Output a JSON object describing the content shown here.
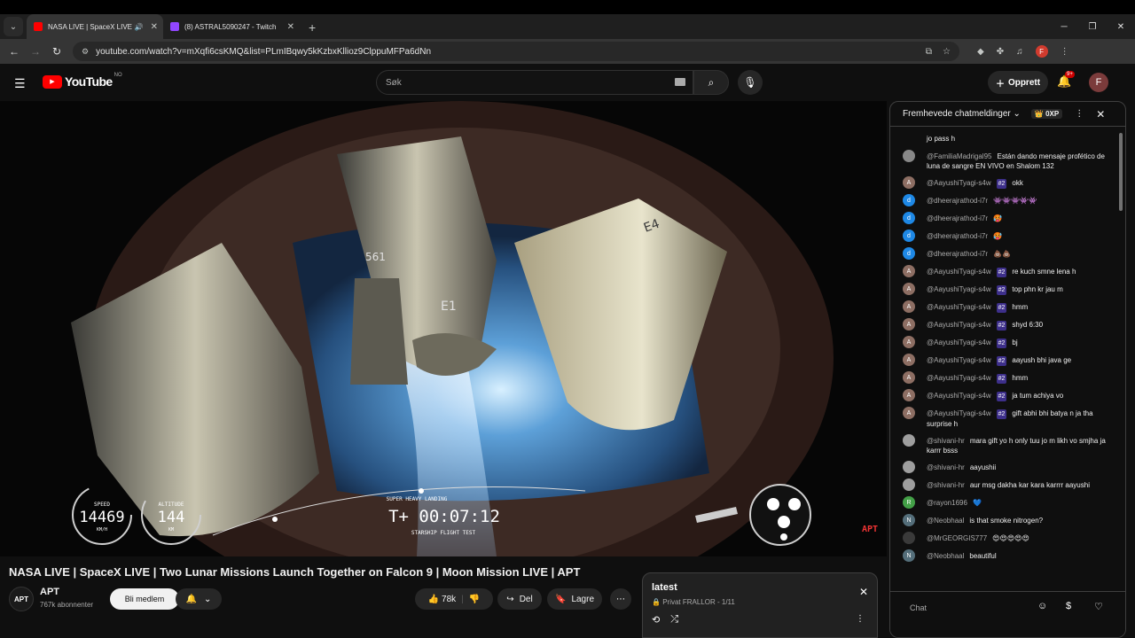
{
  "browser": {
    "tabs": [
      {
        "title": "NASA LIVE | SpaceX LIVE | T",
        "active": true
      },
      {
        "title": "(8) ASTRAL5090247 - Twitch",
        "active": false
      }
    ],
    "url": "youtube.com/watch?v=mXqfi6csKMQ&list=PLmIBqwy5kKzbxKllioz9ClppuMFPa6dNn",
    "profile_initial": "F"
  },
  "youtube": {
    "logo": "YouTube",
    "region": "NO",
    "search_placeholder": "Søk",
    "create_label": "Opprett",
    "notif_badge": "9+",
    "avatar_initial": "F"
  },
  "video": {
    "title": "NASA LIVE | SpaceX LIVE | Two Lunar Missions Launch Together on Falcon 9 | Moon Mission LIVE | APT",
    "hud": {
      "speed_label": "SPEED",
      "speed_value": "14469",
      "speed_unit": "KM/H",
      "altitude_label": "ALTITUDE",
      "altitude_value": "144",
      "altitude_unit": "KM",
      "event": "SUPER HEAVY LANDING",
      "timer": "T+ 00:07:12",
      "mission": "STARSHIP FLIGHT TEST",
      "engines": [
        "561",
        "E1",
        "E4"
      ],
      "watermark": "APT"
    }
  },
  "channel": {
    "logo_text": "APT",
    "name": "APT",
    "subs": "767k abonnenter",
    "member_btn": "Bli medlem"
  },
  "actions": {
    "likes": "78k",
    "share": "Del",
    "save": "Lagre"
  },
  "playlist": {
    "title": "latest",
    "subtitle": "Privat FRALLOR - 1/11"
  },
  "chat": {
    "header": "Fremhevede chatmeldinger",
    "xp": "0XP",
    "input_placeholder": "Chat",
    "messages": [
      {
        "author": "",
        "badge": "",
        "text": "jo pass h",
        "avatar": "",
        "color": "#777777"
      },
      {
        "author": "@FamiliaMadrigal95",
        "badge": "",
        "text": "Están dando mensaje profético de luna de sangre EN VIVO en Shalom 132",
        "avatar": "",
        "color": "#888888"
      },
      {
        "author": "@AayushiTyagi-s4w",
        "badge": "#2",
        "text": "okk",
        "avatar": "A",
        "color": "#8d6e63"
      },
      {
        "author": "@dheerajrathod-i7r",
        "badge": "",
        "text": "👾👾👾👾👾",
        "avatar": "d",
        "color": "#1e88e5"
      },
      {
        "author": "@dheerajrathod-i7r",
        "badge": "",
        "text": "🥵",
        "avatar": "d",
        "color": "#1e88e5"
      },
      {
        "author": "@dheerajrathod-i7r",
        "badge": "",
        "text": "🥵",
        "avatar": "d",
        "color": "#1e88e5"
      },
      {
        "author": "@dheerajrathod-i7r",
        "badge": "",
        "text": "💩💩",
        "avatar": "d",
        "color": "#1e88e5"
      },
      {
        "author": "@AayushiTyagi-s4w",
        "badge": "#2",
        "text": "re kuch smne lena h",
        "avatar": "A",
        "color": "#8d6e63"
      },
      {
        "author": "@AayushiTyagi-s4w",
        "badge": "#2",
        "text": "top phn kr jau m",
        "avatar": "A",
        "color": "#8d6e63"
      },
      {
        "author": "@AayushiTyagi-s4w",
        "badge": "#2",
        "text": "hmm",
        "avatar": "A",
        "color": "#8d6e63"
      },
      {
        "author": "@AayushiTyagi-s4w",
        "badge": "#2",
        "text": "shyd 6:30",
        "avatar": "A",
        "color": "#8d6e63"
      },
      {
        "author": "@AayushiTyagi-s4w",
        "badge": "#2",
        "text": "bj",
        "avatar": "A",
        "color": "#8d6e63"
      },
      {
        "author": "@AayushiTyagi-s4w",
        "badge": "#2",
        "text": "aayush bhi java ge",
        "avatar": "A",
        "color": "#8d6e63"
      },
      {
        "author": "@AayushiTyagi-s4w",
        "badge": "#2",
        "text": "hmm",
        "avatar": "A",
        "color": "#8d6e63"
      },
      {
        "author": "@AayushiTyagi-s4w",
        "badge": "#2",
        "text": "ja tum achiya vo",
        "avatar": "A",
        "color": "#8d6e63"
      },
      {
        "author": "@AayushiTyagi-s4w",
        "badge": "#2",
        "text": "gift abhi bhi batya n ja tha surprise h",
        "avatar": "A",
        "color": "#8d6e63"
      },
      {
        "author": "@shivani-hr",
        "badge": "",
        "text": "mara gift yo h only tuu jo m likh vo smjha ja karrr bsss",
        "avatar": "",
        "color": "#9e9e9e"
      },
      {
        "author": "@shivani-hr",
        "badge": "",
        "text": "aayushii",
        "avatar": "",
        "color": "#9e9e9e"
      },
      {
        "author": "@shivani-hr",
        "badge": "",
        "text": "aur msg dakha kar kara karrrr aayushi",
        "avatar": "",
        "color": "#9e9e9e"
      },
      {
        "author": "@rayon1696",
        "badge": "",
        "text": "💙",
        "avatar": "R",
        "color": "#43a047"
      },
      {
        "author": "@Neobhaal",
        "badge": "",
        "text": "is that smoke nitrogen?",
        "avatar": "N",
        "color": "#546e7a"
      },
      {
        "author": "@MrGEORGIS777",
        "badge": "",
        "text": "😍😍😍😍😍",
        "avatar": "",
        "color": "#3a3a3a"
      },
      {
        "author": "@Neobhaal",
        "badge": "",
        "text": "beautiful",
        "avatar": "N",
        "color": "#546e7a"
      }
    ]
  }
}
